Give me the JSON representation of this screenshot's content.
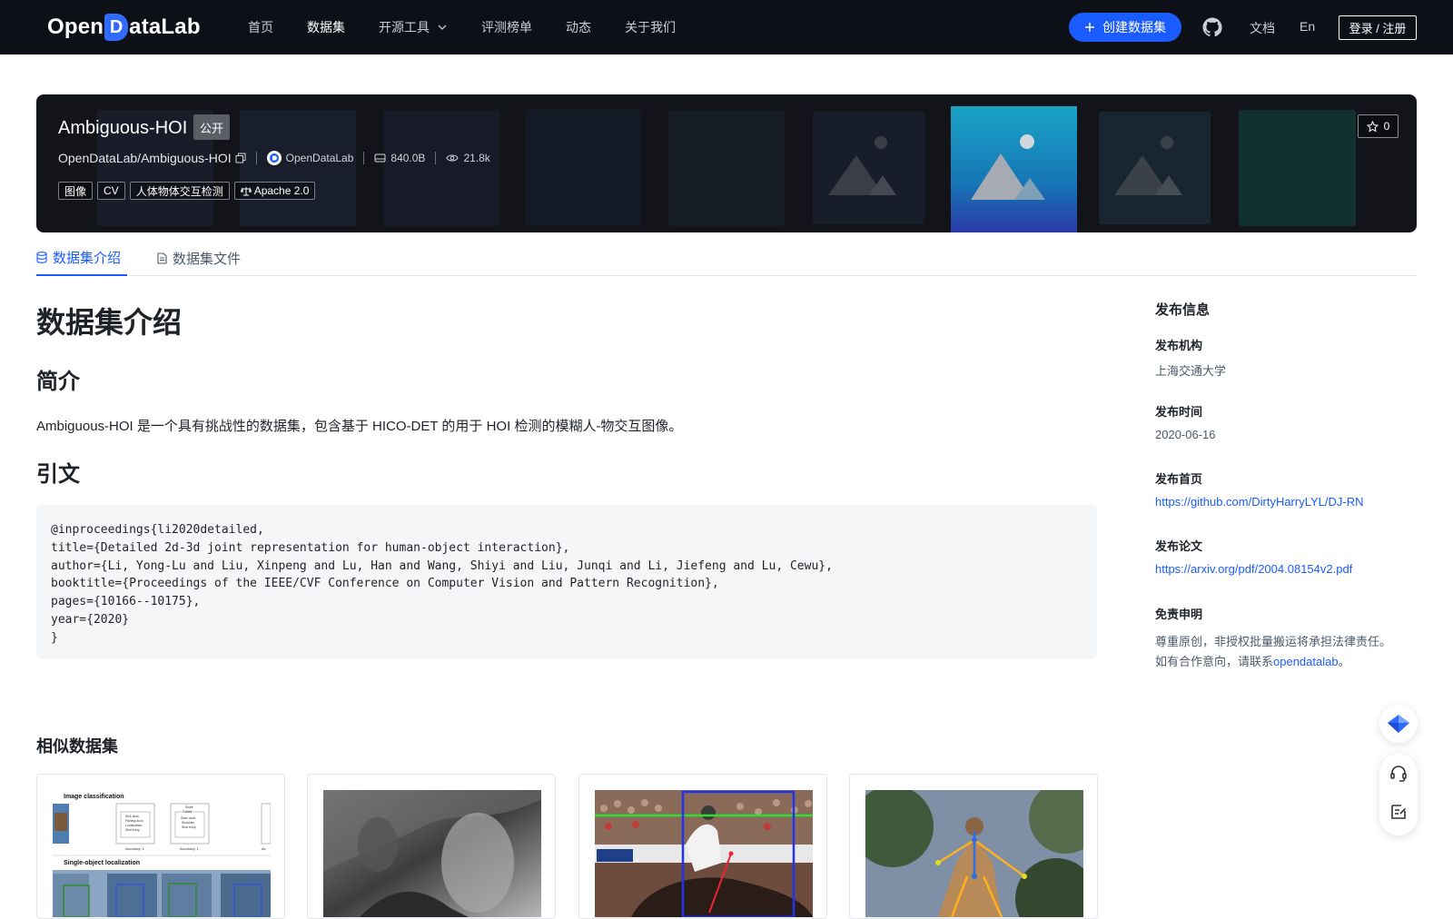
{
  "nav": {
    "logo_text_left": "Open",
    "logo_mark": "D",
    "logo_text_right": "ataLab",
    "items": [
      {
        "label": "首页",
        "active": false
      },
      {
        "label": "数据集",
        "active": true
      },
      {
        "label": "开源工具",
        "active": false,
        "dropdown": true
      },
      {
        "label": "评测榜单",
        "active": false
      },
      {
        "label": "动态",
        "active": false
      },
      {
        "label": "关于我们",
        "active": false
      }
    ],
    "create_label": "创建数据集",
    "github_icon": "github-icon",
    "docs_label": "文档",
    "lang_label": "En",
    "login_label": "登录 / 注册"
  },
  "dataset": {
    "title": "Ambiguous-HOI",
    "visibility": "公开",
    "path": "OpenDataLab/Ambiguous-HOI",
    "org": "OpenDataLab",
    "size": "840.0B",
    "views": "21.8k",
    "tags": [
      "图像",
      "CV",
      "人体物体交互检测"
    ],
    "license": "Apache 2.0",
    "stars": "0"
  },
  "tabs": [
    {
      "label": "数据集介绍",
      "active": true,
      "icon": "database-icon"
    },
    {
      "label": "数据集文件",
      "active": false,
      "icon": "file-icon"
    }
  ],
  "content": {
    "heading": "数据集介绍",
    "intro_heading": "简介",
    "intro_text": "Ambiguous-HOI 是一个具有挑战性的数据集，包含基于 HICO-DET 的用于 HOI 检测的模糊人-物交互图像。",
    "citation_heading": "引文",
    "citation_code": "@inproceedings{li2020detailed,\ntitle={Detailed 2d-3d joint representation for human-object interaction},\nauthor={Li, Yong-Lu and Liu, Xinpeng and Lu, Han and Wang, Shiyi and Liu, Junqi and Li, Jiefeng and Lu, Cewu},\nbooktitle={Proceedings of the IEEE/CVF Conference on Computer Vision and Pattern Recognition},\npages={10166--10175},\nyear={2020}\n}",
    "similar_heading": "相似数据集"
  },
  "sidebar": {
    "title": "发布信息",
    "org_label": "发布机构",
    "org_value": "上海交通大学",
    "date_label": "发布时间",
    "date_value": "2020-06-16",
    "homepage_label": "发布首页",
    "homepage_value": "https://github.com/DirtyHarryLYL/DJ-RN",
    "paper_label": "发布论文",
    "paper_value": "https://arxiv.org/pdf/2004.08154v2.pdf",
    "disclaimer_label": "免责申明",
    "disclaimer_line1": "尊重原创，非授权批量搬运将承担法律责任。",
    "disclaimer_line2_prefix": "如有合作意向，请联系",
    "disclaimer_link": "opendatalab",
    "disclaimer_suffix": "。"
  },
  "similar_cards": [
    {
      "icon": "image-classification-figure",
      "figure_text": {
        "heading_1": "Image classification",
        "row_1": [
          "Sick duck\nFishing duck\nLocalization\nShot boxy",
          "Scale\nT-shirt\nSlam duck\nShoulder\nShot boxy",
          "Gar\nBlu\nBlu\nSho"
        ],
        "row_1_footer": [
          "Accuracy: 1",
          "Accuracy: 1",
          "Ac"
        ],
        "heading_2": "Single-object localization"
      }
    },
    {
      "icon": "closeup-photo-thumbnail"
    },
    {
      "icon": "horse-racing-photo-thumbnail"
    },
    {
      "icon": "pose-keypoints-photo-thumbnail"
    }
  ],
  "colors": {
    "nav_bg": "#0d1117",
    "accent": "#1a5cff",
    "banner_bg": "#121419",
    "highlight_thumb": "#1b9fc4"
  }
}
